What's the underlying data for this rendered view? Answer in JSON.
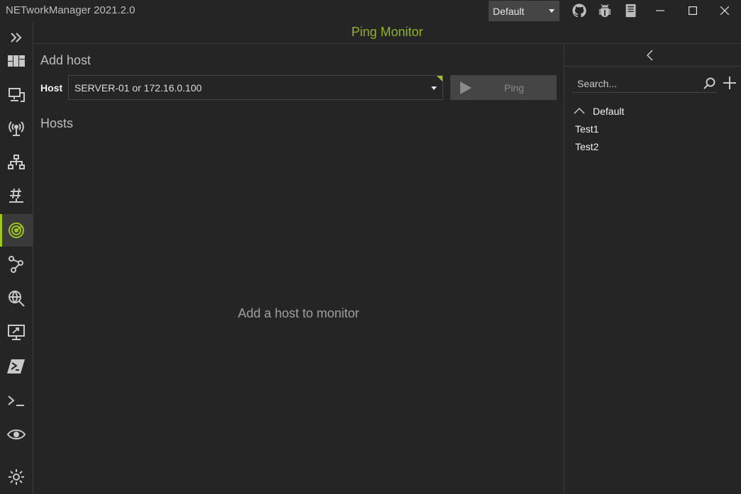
{
  "app": {
    "title": "NETworkManager 2021.2.0",
    "profile_file": "Default",
    "accent_color": "#9ec522"
  },
  "titlebar_icons": [
    "github-icon",
    "bug-report-icon",
    "documentation-icon"
  ],
  "window_controls": [
    "minimize-icon",
    "maximize-icon",
    "close-icon"
  ],
  "nav": {
    "expand_icon": "chevron-double-right-icon",
    "items": [
      {
        "name": "dashboard",
        "icon": "dashboard-icon",
        "active": false
      },
      {
        "name": "network-interface",
        "icon": "network-interface-icon",
        "active": false
      },
      {
        "name": "wifi",
        "icon": "wifi-antenna-icon",
        "active": false
      },
      {
        "name": "ip-scanner",
        "icon": "network-scan-icon",
        "active": false
      },
      {
        "name": "subnet-calculator",
        "icon": "subnet-hash-icon",
        "active": false
      },
      {
        "name": "ping-monitor",
        "icon": "radar-icon",
        "active": true
      },
      {
        "name": "traceroute",
        "icon": "route-icon",
        "active": false
      },
      {
        "name": "dns-lookup",
        "icon": "globe-search-icon",
        "active": false
      },
      {
        "name": "remote-desktop",
        "icon": "remote-desktop-icon",
        "active": false
      },
      {
        "name": "powershell",
        "icon": "powershell-icon",
        "active": false
      },
      {
        "name": "putty",
        "icon": "terminal-icon",
        "active": false
      },
      {
        "name": "tightvnc",
        "icon": "eye-icon",
        "active": false
      }
    ],
    "settings_icon": "gear-icon"
  },
  "header": {
    "title": "Ping Monitor"
  },
  "main": {
    "add_host_heading": "Add host",
    "host_label": "Host",
    "host_placeholder": "SERVER-01 or 172.16.0.100",
    "ping_button_label": "Ping",
    "hosts_heading": "Hosts",
    "empty_message": "Add a host to monitor"
  },
  "profiles_panel": {
    "search_placeholder": "Search...",
    "group_name": "Default",
    "profiles": [
      "Test1",
      "Test2"
    ]
  }
}
